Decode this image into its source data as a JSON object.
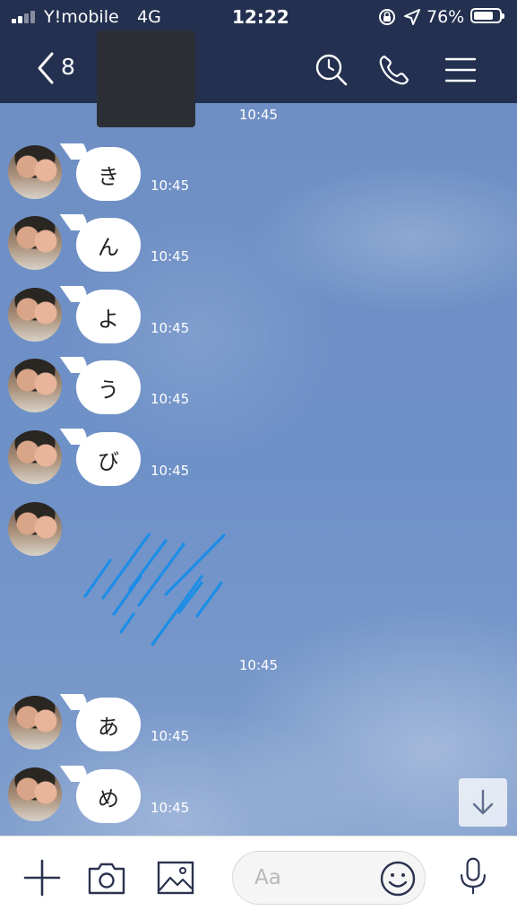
{
  "status_bar": {
    "carrier": "Y!mobile",
    "network": "4G",
    "time": "12:22",
    "battery_percent": "76%",
    "battery_level": 0.76,
    "signal_bars": 2
  },
  "header": {
    "unread_count": "8",
    "icons": [
      "back-chevron",
      "history-search",
      "phone",
      "menu"
    ]
  },
  "chat": {
    "date_separator_times": [
      "10:45",
      "10:45"
    ],
    "messages": [
      {
        "text": "き",
        "time": "10:45"
      },
      {
        "text": "ん",
        "time": "10:45"
      },
      {
        "text": "よ",
        "time": "10:45"
      },
      {
        "text": "う",
        "time": "10:45"
      },
      {
        "text": "び",
        "time": "10:45"
      }
    ],
    "sticker": {
      "kind": "rain-lines-sticker",
      "color": "#1c8de6"
    },
    "messages_after": [
      {
        "text": "あ",
        "time": "10:45"
      },
      {
        "text": "め",
        "time": "10:45"
      }
    ]
  },
  "input_bar": {
    "placeholder": "Aa",
    "icons": [
      "plus",
      "camera",
      "image",
      "emoji",
      "microphone"
    ]
  },
  "colors": {
    "header_bg": "#233050",
    "chat_bg": "#6f8fc4",
    "bubble": "#ffffff"
  }
}
